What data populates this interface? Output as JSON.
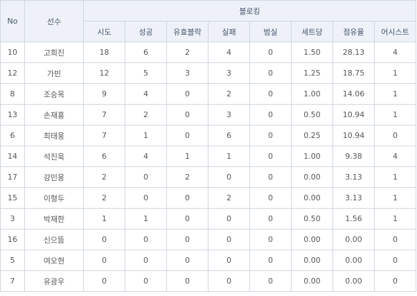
{
  "header": {
    "no": "No",
    "player": "선수",
    "group": "블로킹",
    "columns": [
      "시도",
      "성공",
      "유효블락",
      "실패",
      "범실",
      "세트당",
      "점유율",
      "어시스트"
    ]
  },
  "rows": [
    [
      "10",
      "고희진",
      "18",
      "6",
      "2",
      "4",
      "0",
      "1.50",
      "28.13",
      "4"
    ],
    [
      "12",
      "가빈",
      "12",
      "5",
      "3",
      "3",
      "0",
      "1.25",
      "18.75",
      "1"
    ],
    [
      "8",
      "조승목",
      "9",
      "4",
      "0",
      "2",
      "0",
      "1.00",
      "14.06",
      "1"
    ],
    [
      "13",
      "손재홍",
      "7",
      "2",
      "0",
      "3",
      "0",
      "0.50",
      "10.94",
      "1"
    ],
    [
      "6",
      "최태웅",
      "7",
      "1",
      "0",
      "6",
      "0",
      "0.25",
      "10.94",
      "0"
    ],
    [
      "14",
      "석진욱",
      "6",
      "4",
      "1",
      "1",
      "0",
      "1.00",
      "9.38",
      "4"
    ],
    [
      "17",
      "강민웅",
      "2",
      "0",
      "2",
      "0",
      "0",
      "0.00",
      "3.13",
      "1"
    ],
    [
      "15",
      "이형두",
      "2",
      "0",
      "0",
      "2",
      "0",
      "0.00",
      "3.13",
      "1"
    ],
    [
      "3",
      "박재한",
      "1",
      "1",
      "0",
      "0",
      "0",
      "0.50",
      "1.56",
      "1"
    ],
    [
      "16",
      "신으뜸",
      "0",
      "0",
      "0",
      "0",
      "0",
      "0.00",
      "0.00",
      "0"
    ],
    [
      "5",
      "여오현",
      "0",
      "0",
      "0",
      "0",
      "0",
      "0.00",
      "0.00",
      "0"
    ],
    [
      "7",
      "유광우",
      "0",
      "0",
      "0",
      "0",
      "0",
      "0.00",
      "0.00",
      "0"
    ]
  ]
}
